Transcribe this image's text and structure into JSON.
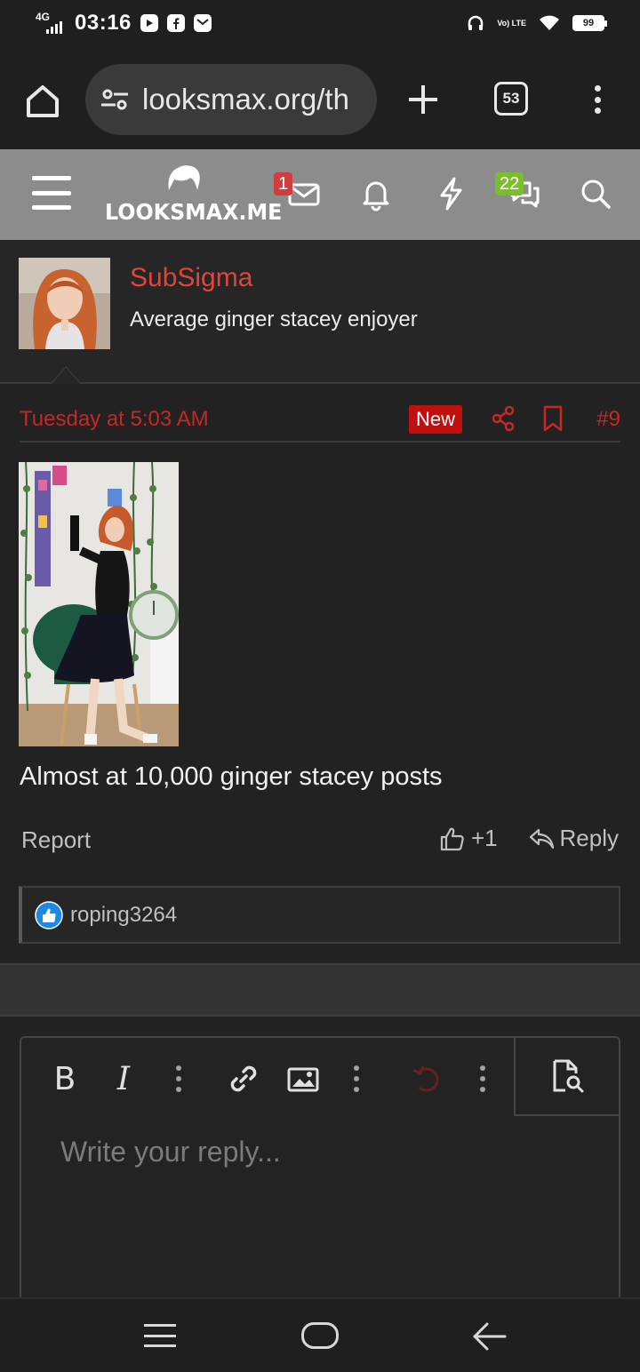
{
  "status_bar": {
    "network": "4G",
    "time": "03:16",
    "volte": "Vo) LTE",
    "battery": "99",
    "icons": [
      "youtube-icon",
      "facebook-icon",
      "gmail-icon",
      "headphones-icon",
      "wifi-icon"
    ]
  },
  "browser": {
    "url": "looksmax.org/th",
    "tab_count": "53"
  },
  "site_nav": {
    "logo_text": "LOOKSMAX.ME",
    "inbox_badge": "1",
    "chat_badge": "22"
  },
  "post": {
    "author": "SubSigma",
    "author_title": "Average ginger stacey enjoyer",
    "date": "Tuesday at 5:03 AM",
    "new_label": "New",
    "post_number": "#9",
    "text": "Almost at 10,000 ginger stacey posts",
    "report_label": "Report",
    "like_count": "+1",
    "reply_label": "Reply",
    "reaction_user": "roping3264"
  },
  "editor": {
    "bold_label": "B",
    "italic_label": "I",
    "placeholder": "Write your reply..."
  },
  "colors": {
    "accent_red": "#e0443a",
    "date_red": "#c82727",
    "badge_green": "#7cbd2b",
    "nav_gray": "#8c8c8c"
  }
}
